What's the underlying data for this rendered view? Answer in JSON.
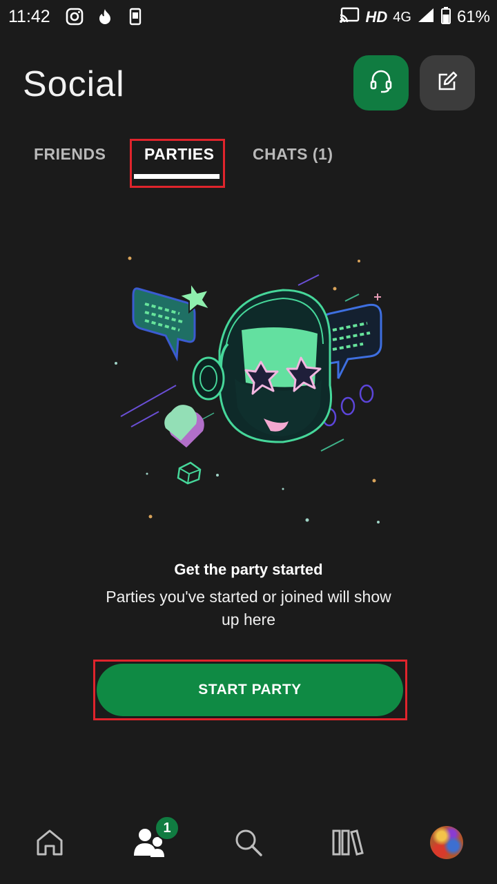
{
  "status_bar": {
    "time": "11:42",
    "left_icons": [
      "instagram-icon",
      "tinder-icon",
      "phone-icon"
    ],
    "right": {
      "cast_icon": "cast-icon",
      "hd": "HD",
      "network": "4G",
      "signal_icon": "signal-icon",
      "battery_icon": "battery-icon",
      "battery": "61%"
    }
  },
  "header": {
    "title": "Social",
    "party_button_icon": "headset-icon",
    "compose_button_icon": "compose-icon"
  },
  "tabs": [
    {
      "label": "FRIENDS",
      "selected": false
    },
    {
      "label": "PARTIES",
      "selected": true
    },
    {
      "label": "CHATS (1)",
      "selected": false
    }
  ],
  "empty_state": {
    "title": "Get the party started",
    "subtitle": "Parties you've started or joined will show up here"
  },
  "start_party": {
    "label": "START PARTY"
  },
  "bottom_nav": {
    "items": [
      "home-icon",
      "people-icon",
      "search-icon",
      "library-icon",
      "avatar"
    ],
    "people_badge": "1"
  },
  "colors": {
    "background": "#1b1b1b",
    "accent_green": "#107c41",
    "button_green": "#0f8a44",
    "highlight_red": "#e0242c"
  }
}
